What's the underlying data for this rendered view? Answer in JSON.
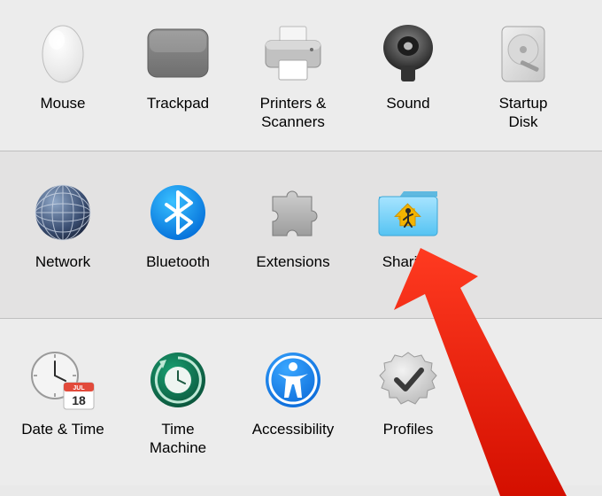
{
  "rows": [
    {
      "items": [
        {
          "name": "mouse",
          "label": "Mouse"
        },
        {
          "name": "trackpad",
          "label": "Trackpad"
        },
        {
          "name": "printers-scanners",
          "label": "Printers &\nScanners"
        },
        {
          "name": "sound",
          "label": "Sound"
        },
        {
          "name": "startup-disk",
          "label": "Startup\nDisk"
        }
      ]
    },
    {
      "items": [
        {
          "name": "network",
          "label": "Network"
        },
        {
          "name": "bluetooth",
          "label": "Bluetooth"
        },
        {
          "name": "extensions",
          "label": "Extensions"
        },
        {
          "name": "sharing",
          "label": "Sharing"
        }
      ]
    },
    {
      "items": [
        {
          "name": "date-time",
          "label": "Date & Time"
        },
        {
          "name": "time-machine",
          "label": "Time\nMachine"
        },
        {
          "name": "accessibility",
          "label": "Accessibility"
        },
        {
          "name": "profiles",
          "label": "Profiles"
        }
      ]
    }
  ]
}
